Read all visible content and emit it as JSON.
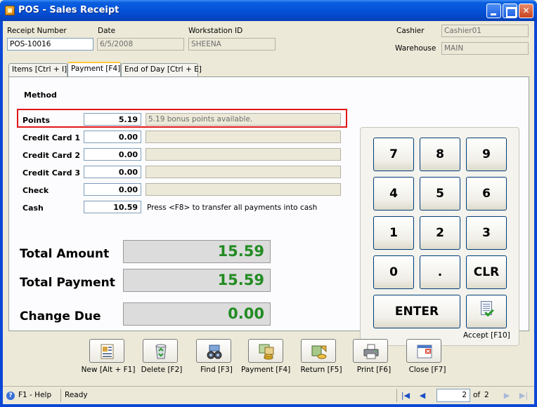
{
  "window": {
    "title": "POS - Sales Receipt"
  },
  "header": {
    "receipt_number_label": "Receipt Number",
    "receipt_number": "POS-10016",
    "date_label": "Date",
    "date": "6/5/2008",
    "workstation_label": "Workstation ID",
    "workstation": "SHEENA",
    "cashier_label": "Cashier",
    "cashier": "Cashier01",
    "warehouse_label": "Warehouse",
    "warehouse": "MAIN"
  },
  "tabs": [
    {
      "label": "Items [Ctrl + I]",
      "active": false
    },
    {
      "label": "Payment [F4]",
      "active": true
    },
    {
      "label": "End of Day [Ctrl + E]",
      "active": false
    }
  ],
  "payment": {
    "method_label": "Method",
    "rows": [
      {
        "label": "Points",
        "amount": "5.19",
        "desc": "5.19 bonus points available."
      },
      {
        "label": "Credit Card 1",
        "amount": "0.00",
        "desc": ""
      },
      {
        "label": "Credit Card 2",
        "amount": "0.00",
        "desc": ""
      },
      {
        "label": "Credit Card 3",
        "amount": "0.00",
        "desc": ""
      },
      {
        "label": "Check",
        "amount": "0.00",
        "desc": ""
      },
      {
        "label": "Cash",
        "amount": "10.59",
        "desc": ""
      }
    ],
    "cash_hint": "Press <F8> to transfer all payments into cash"
  },
  "totals": {
    "total_amount_label": "Total Amount",
    "total_amount": "15.59",
    "total_payment_label": "Total Payment",
    "total_payment": "15.59",
    "change_due_label": "Change Due",
    "change_due": "0.00",
    "value_color": "#228b22"
  },
  "keypad": {
    "keys": [
      "7",
      "8",
      "9",
      "4",
      "5",
      "6",
      "1",
      "2",
      "3",
      "0",
      ".",
      "CLR"
    ],
    "enter": "ENTER",
    "accept_label": "Accept [F10]",
    "accept_icon": "accept-document-check-icon"
  },
  "toolbar": {
    "buttons": [
      {
        "label": "New [Alt + F1]",
        "icon": "new-receipt-icon"
      },
      {
        "label": "Delete [F2]",
        "icon": "recycle-bin-icon"
      },
      {
        "label": "Find [F3]",
        "icon": "binoculars-icon"
      },
      {
        "label": "Payment [F4]",
        "icon": "payment-coins-icon"
      },
      {
        "label": "Return [F5]",
        "icon": "return-coins-icon"
      },
      {
        "label": "Print [F6]",
        "icon": "printer-icon"
      },
      {
        "label": "Close [F7]",
        "icon": "close-window-icon"
      }
    ]
  },
  "statusbar": {
    "help": "F1 - Help",
    "status": "Ready",
    "page": "2",
    "of_label": "of",
    "total_pages": "2"
  },
  "colors": {
    "titlebar": "#0552d8",
    "highlight_border": "#e01818",
    "total_value": "#228b22"
  }
}
